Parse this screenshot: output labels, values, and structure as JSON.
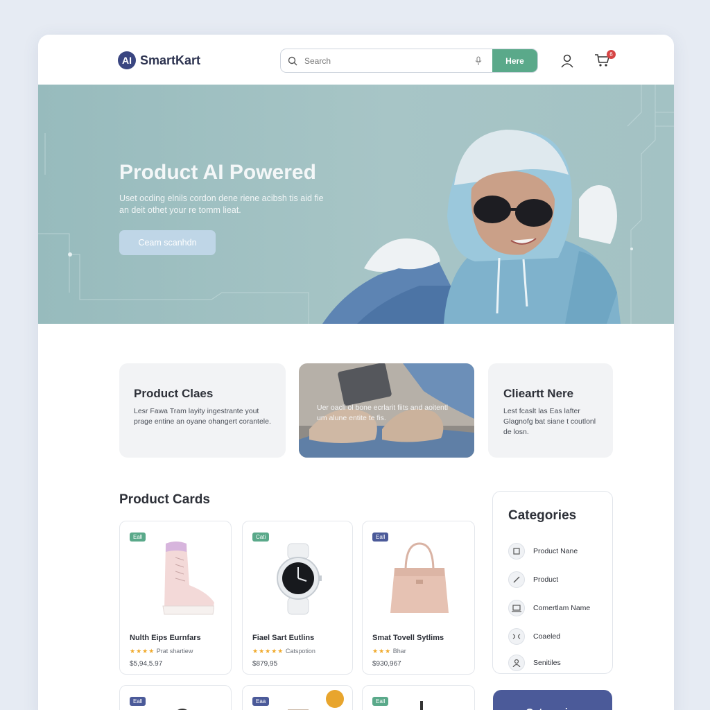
{
  "brand": {
    "logo_mark": "AI",
    "name": "SmartKart"
  },
  "search": {
    "placeholder": "Search",
    "button_label": "Here"
  },
  "header": {
    "cart_count": "6"
  },
  "hero": {
    "title": "Product AI Powered",
    "subtitle": "Uset ocding elnils cordon dene riene acibsh tis aid fie an deit othet your re tomm lieat.",
    "button_label": "Ceam scanhdn"
  },
  "features": [
    {
      "title": "Product Claes",
      "text": "Lesr Fawa Tram layity ingestrante yout prage entine an oyane ohangert corantele."
    },
    {
      "text": "Uer oacli ol bone ecrlarit fiits and aoitentl um alune entite te fis."
    },
    {
      "title": "Clieartt Nere",
      "text": "Lest fcaslt las Eas lafter Glagnofg bat siane t coutlonl de losn."
    }
  ],
  "products_section": {
    "title": "Product Cards"
  },
  "products": [
    {
      "tag": "Eall",
      "name": "Nulth Eips Eurnfars",
      "rating_text": "Prat shartiew",
      "price": "$5,94,5.97"
    },
    {
      "tag": "Cati",
      "name": "Fiael Sart Eutlins",
      "rating_text": "Catspotion",
      "price": "$879,95"
    },
    {
      "tag": "Eall",
      "name": "Smat Tovell Sytlims",
      "rating_text": "Bhar",
      "price": "$930,967"
    }
  ],
  "products_row2": [
    {
      "tag": "Eall"
    },
    {
      "tag": "Eaa"
    },
    {
      "tag": "Eall"
    }
  ],
  "categories": {
    "title": "Categories",
    "items": [
      {
        "label": "Product Nane",
        "icon": "tag-icon"
      },
      {
        "label": "Product",
        "icon": "pen-icon"
      },
      {
        "label": "Comertlam Name",
        "icon": "laptop-icon"
      },
      {
        "label": "Coaeled",
        "icon": "link-icon"
      },
      {
        "label": "Senitiles",
        "icon": "user-icon"
      }
    ],
    "button_label": "Categories"
  },
  "colors": {
    "accent_green": "#5aa98a",
    "accent_navy": "#4b5a99",
    "hero_bg": "#a3c2c4",
    "badge_red": "#d64545"
  }
}
